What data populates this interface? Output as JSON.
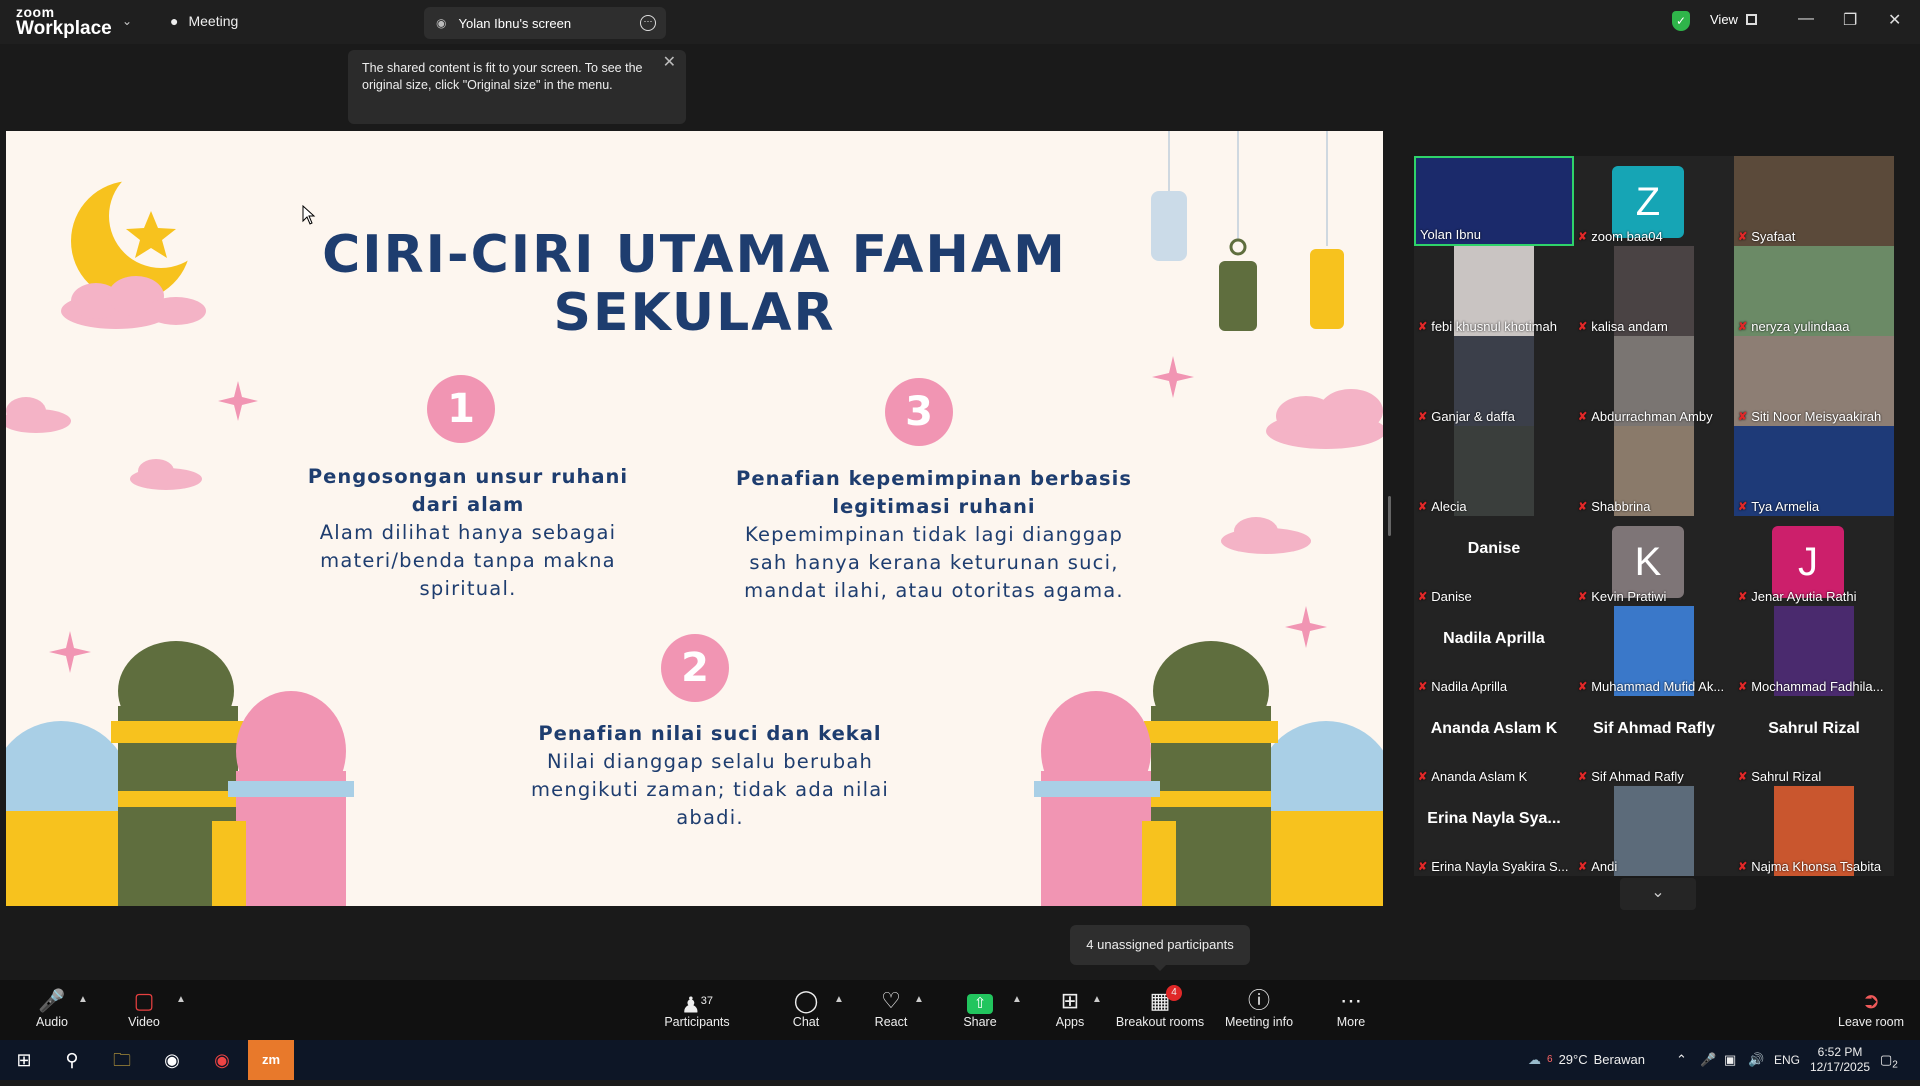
{
  "app": {
    "logo_line1": "zoom",
    "logo_line2": "Workplace",
    "meeting_label": "Meeting",
    "screen_tab": "Yolan Ibnu's screen",
    "view_label": "View"
  },
  "tooltip": {
    "text": "The shared content is fit to your screen. To see the original size, click \"Original size\" in the menu."
  },
  "slide": {
    "title_line1": "CIRI-CIRI UTAMA FAHAM",
    "title_line2": "SEKULAR",
    "points": [
      {
        "num": "1",
        "heading": "Pengosongan unsur ruhani dari alam",
        "body": "Alam dilihat hanya sebagai materi/benda tanpa makna spiritual."
      },
      {
        "num": "3",
        "heading": "Penafian kepemimpinan berbasis legitimasi ruhani",
        "body": "Kepemimpinan tidak lagi dianggap sah hanya kerana keturunan suci, mandat ilahi, atau otoritas agama."
      },
      {
        "num": "2",
        "heading": "Penafian nilai suci dan kekal",
        "body": "Nilai dianggap selalu berubah mengikuti zaman; tidak ada nilai abadi."
      }
    ]
  },
  "participants": [
    {
      "name": "Yolan Ibnu",
      "type": "video",
      "color": "#1b2a6b"
    },
    {
      "name": "zoom baa04",
      "type": "avatar",
      "letter": "Z",
      "color": "#16a5b5"
    },
    {
      "name": "Syafaat",
      "type": "video",
      "color": "#5b4a3a"
    },
    {
      "name": "febi khusnul khotimah",
      "type": "video",
      "color": "#c9c4c2"
    },
    {
      "name": "kalisa andam",
      "type": "video",
      "color": "#4a4344"
    },
    {
      "name": "neryza yulindaaa",
      "type": "video",
      "color": "#6b8a66"
    },
    {
      "name": "Ganjar & daffa",
      "type": "video",
      "color": "#3b3f4a"
    },
    {
      "name": "Abdurrachman Amby",
      "type": "video",
      "color": "#7a7572"
    },
    {
      "name": "Siti Noor Meisyaakirah",
      "type": "video",
      "color": "#8d7e74"
    },
    {
      "name": "Alecia",
      "type": "video",
      "color": "#3a3e3c"
    },
    {
      "name": "Shabbrina",
      "type": "video",
      "color": "#8a7a6a"
    },
    {
      "name": "Tya Armelia",
      "type": "video",
      "color": "#1e3a78"
    },
    {
      "name": "Danise",
      "type": "name",
      "display": "Danise"
    },
    {
      "name": "Kevin Pratiwi",
      "type": "avatar",
      "letter": "K",
      "color": "#7e7577"
    },
    {
      "name": "Jenar Ayutia Rathi",
      "type": "avatar",
      "letter": "J",
      "color": "#cc1f6b"
    },
    {
      "name": "Nadila Aprilla",
      "type": "name",
      "display": "Nadila Aprilla"
    },
    {
      "name": "Muhammad Mufid Ak...",
      "type": "video",
      "color": "#3a78c9"
    },
    {
      "name": "Mochammad Fadhila...",
      "type": "video",
      "color": "#4a2a6e"
    },
    {
      "name": "Ananda Aslam K",
      "type": "name",
      "display": "Ananda Aslam K"
    },
    {
      "name": "Sif Ahmad Rafly",
      "type": "name",
      "display": "Sif Ahmad Rafly"
    },
    {
      "name": "Sahrul Rizal",
      "type": "name",
      "display": "Sahrul Rizal"
    },
    {
      "name": "Erina Nayla Syakira S...",
      "type": "name",
      "display": "Erina Nayla Sya..."
    },
    {
      "name": "Andi",
      "type": "video",
      "color": "#5c6b7a"
    },
    {
      "name": "Najma Khonsa Tsabita",
      "type": "video",
      "color": "#c9562e"
    }
  ],
  "unassigned": "4 unassigned participants",
  "toolbar": {
    "audio": "Audio",
    "video": "Video",
    "participants": "Participants",
    "participants_count": "37",
    "chat": "Chat",
    "react": "React",
    "share": "Share",
    "apps": "Apps",
    "breakout": "Breakout rooms",
    "breakout_badge": "4",
    "info": "Meeting info",
    "more": "More",
    "leave": "Leave room"
  },
  "taskbar": {
    "weather_temp": "29°C",
    "weather_text": "Berawan",
    "weather_badge": "6",
    "lang": "ENG",
    "time": "6:52 PM",
    "date": "12/17/2025",
    "notif": "2"
  }
}
